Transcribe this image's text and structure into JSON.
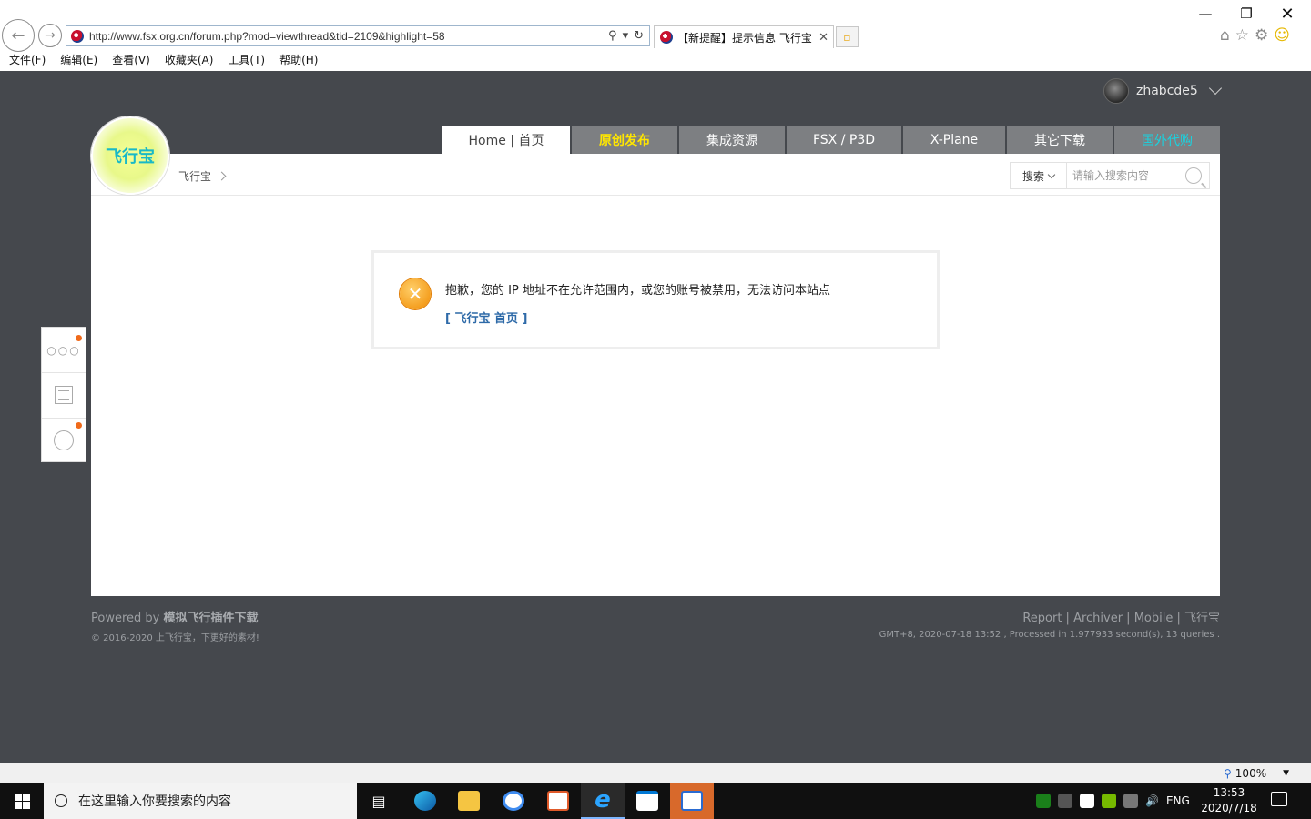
{
  "browser": {
    "url": "http://www.fsx.org.cn/forum.php?mod=viewthread&tid=2109&highlight=58",
    "tab_title": "【新提醒】提示信息  飞行宝",
    "menu": [
      "文件(F)",
      "编辑(E)",
      "查看(V)",
      "收藏夹(A)",
      "工具(T)",
      "帮助(H)"
    ],
    "zoom": "100%"
  },
  "site": {
    "username": "zhabcde5",
    "logo_text": "飞行宝",
    "nav": [
      {
        "label": "Home | 首页",
        "style": "home"
      },
      {
        "label": "原创发布",
        "style": "yellow"
      },
      {
        "label": "集成资源",
        "style": "normal"
      },
      {
        "label": "FSX / P3D",
        "style": "normal"
      },
      {
        "label": "X-Plane",
        "style": "normal"
      },
      {
        "label": "其它下载",
        "style": "normal"
      },
      {
        "label": "国外代购",
        "style": "cyan"
      }
    ],
    "breadcrumb": "飞行宝",
    "search": {
      "select_label": "搜索",
      "placeholder": "请输入搜索内容"
    }
  },
  "alert": {
    "message": "抱歉，您的 IP 地址不在允许范围内，或您的账号被禁用，无法访问本站点",
    "link": "[ 飞行宝 首页 ]"
  },
  "footer": {
    "powered_prefix": "Powered by ",
    "powered_name": "模拟飞行插件下载",
    "copyright": "© 2016-2020 上飞行宝，下更好的素材!",
    "links": "Report | Archiver | Mobile | 飞行宝",
    "processed": "GMT+8, 2020-07-18 13:52 , Processed in 1.977933 second(s), 13 queries ."
  },
  "taskbar": {
    "search_placeholder": "在这里输入你要搜索的内容",
    "lang": "ENG",
    "time": "13:53",
    "date": "2020/7/18"
  },
  "colors": {
    "page_bg": "#45484d",
    "nav_tab_bg": "#7d7f82",
    "accent_yellow": "#ffe600",
    "accent_cyan": "#19d3e0",
    "link_blue": "#2e6aa8",
    "error_orange": "#f08a00"
  }
}
